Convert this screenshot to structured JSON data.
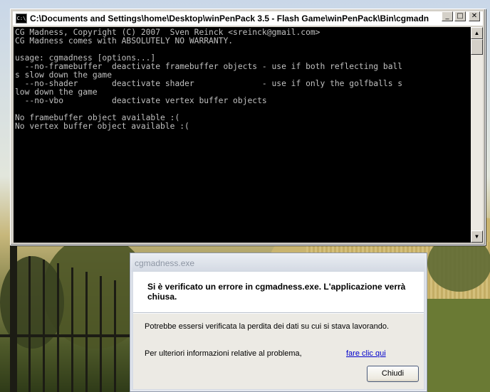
{
  "console": {
    "title": "C:\\Documents and Settings\\home\\Desktop\\winPenPack 3.5 - Flash Game\\winPenPack\\Bin\\cgmadne...",
    "icon": "console-icon",
    "minimize_glyph": "_",
    "maximize_glyph": "□",
    "close_glyph": "✕",
    "scroll_up_glyph": "▲",
    "scroll_down_glyph": "▼",
    "output": "CG Madness, Copyright (C) 2007  Sven Reinck <sreinck@gmail.com>\nCG Madness comes with ABSOLUTELY NO WARRANTY.\n\nusage: cgmadness [options...]\n  --no-framebuffer  deactivate framebuffer objects - use if both reflecting ball\ns slow down the game\n  --no-shader       deactivate shader              - use if only the golfballs s\nlow down the game\n  --no-vbo          deactivate vertex buffer objects\n\nNo framebuffer object available :(\nNo vertex buffer object available :("
  },
  "dialog": {
    "title": "cgmadness.exe",
    "header": "Si è verificato un errore in cgmadness.exe. L'applicazione verrà chiusa.",
    "lost_data_text": "Potrebbe essersi verificata la perdita dei dati su cui si stava lavorando.",
    "more_info_text": "Per ulteriori informazioni relative al problema,",
    "link_text": "fare clic qui",
    "close_label": "Chiudi"
  },
  "colors": {
    "console_bg": "#000000",
    "console_text": "#c0c0c0",
    "link": "#0000cc"
  }
}
